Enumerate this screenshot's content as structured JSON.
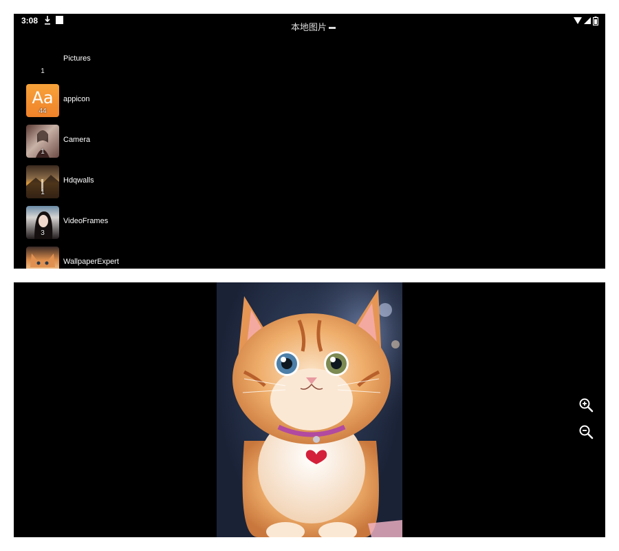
{
  "status_bar": {
    "time": "3:08",
    "icons": [
      "download-icon",
      "notification-square-icon",
      "wifi-icon",
      "signal-icon",
      "battery-icon"
    ]
  },
  "app_bar": {
    "title": "本地图片"
  },
  "albums": [
    {
      "name": "Pictures",
      "count": "1",
      "thumbnail": "none"
    },
    {
      "name": "appicon",
      "count": "44",
      "thumbnail": "app-icon-aa"
    },
    {
      "name": "Camera",
      "count": "1",
      "thumbnail": "camera-photo"
    },
    {
      "name": "Hdqwalls",
      "count": "1",
      "thumbnail": "landscape-photo"
    },
    {
      "name": "VideoFrames",
      "count": "3",
      "thumbnail": "portrait-photo"
    },
    {
      "name": "WallpaperExpert",
      "count": "",
      "thumbnail": "kitten-photo"
    }
  ],
  "appicon_letters": "Aa",
  "viewer": {
    "image": "kitten-with-heart-pendant",
    "controls": [
      "zoom-in-icon",
      "zoom-out-icon"
    ]
  },
  "colors": {
    "background": "#000000",
    "appicon_orange": "#f0822a",
    "heart_red": "#d4203a"
  }
}
